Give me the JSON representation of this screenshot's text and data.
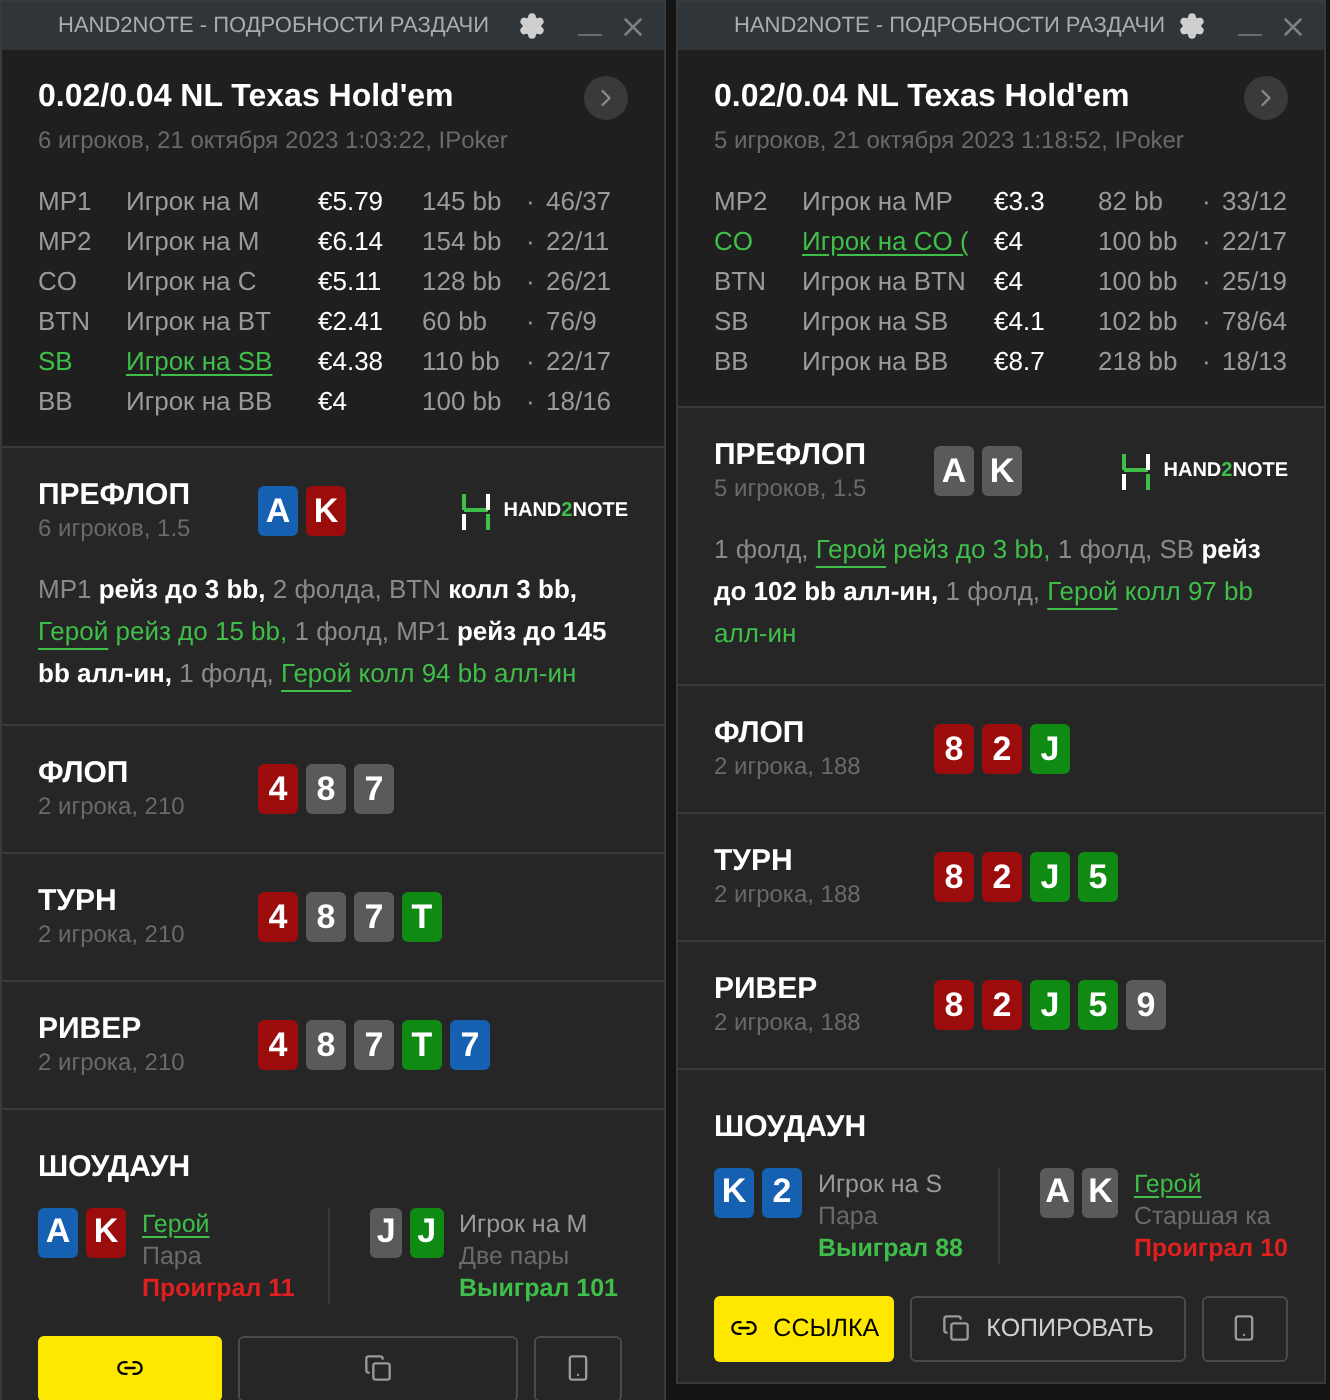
{
  "windows": [
    {
      "title": "HAND2NOTE - ПОДРОБНОСТИ РАЗДАЧИ",
      "game": "0.02/0.04 NL Texas Hold'em",
      "info": "6 игроков, 21 октября 2023 1:03:22, IPoker",
      "players": [
        {
          "pos": "MP1",
          "name": "Игрок на M",
          "stack": "€5.79",
          "bb": "145 bb",
          "dot": "·",
          "stats": "46/37",
          "hero": false
        },
        {
          "pos": "MP2",
          "name": "Игрок на M",
          "stack": "€6.14",
          "bb": "154 bb",
          "dot": "·",
          "stats": "22/11",
          "hero": false
        },
        {
          "pos": "CO",
          "name": "Игрок на C",
          "stack": "€5.11",
          "bb": "128 bb",
          "dot": "·",
          "stats": "26/21",
          "hero": false
        },
        {
          "pos": "BTN",
          "name": "Игрок на BT",
          "stack": "€2.41",
          "bb": "60 bb",
          "dot": "·",
          "stats": "76/9",
          "hero": false
        },
        {
          "pos": "SB",
          "name": "Игрок на SB",
          "stack": "€4.38",
          "bb": "110 bb",
          "dot": "·",
          "stats": "22/17",
          "hero": true
        },
        {
          "pos": "BB",
          "name": "Игрок на BB",
          "stack": "€4",
          "bb": "100 bb",
          "dot": "·",
          "stats": "18/16",
          "hero": false
        }
      ],
      "logo": [
        "HAND",
        "2",
        "NOTE"
      ],
      "streets": [
        {
          "name": "ПРЕФЛОП",
          "info": "6 игроков, 1.5",
          "cards": [
            {
              "rank": "A",
              "color": "#1560b0"
            },
            {
              "rank": "K",
              "color": "#9b0d0d"
            }
          ],
          "actions": [
            {
              "kind": "muted",
              "text": "MP1 "
            },
            {
              "kind": "action",
              "text": "рейз до 3 bb,"
            },
            {
              "kind": "muted",
              "text": " 2 фолда, BTN "
            },
            {
              "kind": "action",
              "text": "колл 3 bb, "
            },
            {
              "kind": "hero_name",
              "text": "Герой"
            },
            {
              "kind": "hero",
              "text": " рейз до 15 bb,"
            },
            {
              "kind": "muted",
              "text": " 1 фолд, MP1 "
            },
            {
              "kind": "action",
              "text": "рейз до 145 bb алл-ин,"
            },
            {
              "kind": "muted",
              "text": " 1 фолд, "
            },
            {
              "kind": "hero_name",
              "text": "Герой"
            },
            {
              "kind": "hero",
              "text": " колл 94 bb алл-ин"
            }
          ]
        },
        {
          "name": "ФЛОП",
          "info": "2 игрока, 210",
          "cards": [
            {
              "rank": "4",
              "color": "#9b0d0d"
            },
            {
              "rank": "8",
              "color": "#5a5a5a"
            },
            {
              "rank": "7",
              "color": "#5a5a5a"
            }
          ]
        },
        {
          "name": "ТУРН",
          "info": "2 игрока, 210",
          "cards": [
            {
              "rank": "4",
              "color": "#9b0d0d"
            },
            {
              "rank": "8",
              "color": "#5a5a5a"
            },
            {
              "rank": "7",
              "color": "#5a5a5a"
            },
            {
              "rank": "T",
              "color": "#0f8a12"
            }
          ]
        },
        {
          "name": "РИВЕР",
          "info": "2 игрока, 210",
          "cards": [
            {
              "rank": "4",
              "color": "#9b0d0d"
            },
            {
              "rank": "8",
              "color": "#5a5a5a"
            },
            {
              "rank": "7",
              "color": "#5a5a5a"
            },
            {
              "rank": "T",
              "color": "#0f8a12"
            },
            {
              "rank": "7",
              "color": "#1560b0"
            }
          ]
        }
      ],
      "showdown": {
        "title": "ШОУДАУН",
        "hands": [
          {
            "cards": [
              {
                "rank": "A",
                "color": "#1560b0"
              },
              {
                "rank": "K",
                "color": "#9b0d0d"
              }
            ],
            "player": "Герой",
            "hero": true,
            "combo": "Пара",
            "result": "Проиграл 11",
            "won": false
          },
          {
            "cards": [
              {
                "rank": "J",
                "color": "#5a5a5a"
              },
              {
                "rank": "J",
                "color": "#0f8a12"
              }
            ],
            "player": "Игрок на M",
            "hero": false,
            "combo": "Две пары",
            "result": "Выиграл 101",
            "won": true
          }
        ]
      }
    },
    {
      "title": "HAND2NOTE - ПОДРОБНОСТИ РАЗДАЧИ",
      "game": "0.02/0.04 NL Texas Hold'em",
      "info": "5 игроков, 21 октября 2023 1:18:52, IPoker",
      "players": [
        {
          "pos": "MP2",
          "name": "Игрок на MP",
          "stack": "€3.3",
          "bb": "82 bb",
          "dot": "·",
          "stats": "33/12",
          "hero": false
        },
        {
          "pos": "CO",
          "name": "Игрок на CO (",
          "stack": "€4",
          "bb": "100 bb",
          "dot": "·",
          "stats": "22/17",
          "hero": true
        },
        {
          "pos": "BTN",
          "name": "Игрок на BTN",
          "stack": "€4",
          "bb": "100 bb",
          "dot": "·",
          "stats": "25/19",
          "hero": false
        },
        {
          "pos": "SB",
          "name": "Игрок на SB",
          "stack": "€4.1",
          "bb": "102 bb",
          "dot": "·",
          "stats": "78/64",
          "hero": false
        },
        {
          "pos": "BB",
          "name": "Игрок на BB",
          "stack": "€8.7",
          "bb": "218 bb",
          "dot": "·",
          "stats": "18/13",
          "hero": false
        }
      ],
      "logo": [
        "HAND",
        "2",
        "NOTE"
      ],
      "streets": [
        {
          "name": "ПРЕФЛОП",
          "info": "5 игроков, 1.5",
          "cards": [
            {
              "rank": "A",
              "color": "#5a5a5a"
            },
            {
              "rank": "K",
              "color": "#5a5a5a"
            }
          ],
          "actions": [
            {
              "kind": "muted",
              "text": "1 фолд, "
            },
            {
              "kind": "hero_name",
              "text": "Герой"
            },
            {
              "kind": "hero",
              "text": " рейз до 3 bb,"
            },
            {
              "kind": "muted",
              "text": " 1 фолд, SB "
            },
            {
              "kind": "action",
              "text": "рейз до 102 bb алл-ин,"
            },
            {
              "kind": "muted",
              "text": " 1 фолд, "
            },
            {
              "kind": "hero_name",
              "text": "Герой"
            },
            {
              "kind": "hero",
              "text": " колл 97 bb алл-ин"
            }
          ]
        },
        {
          "name": "ФЛОП",
          "info": "2 игрока, 188",
          "cards": [
            {
              "rank": "8",
              "color": "#9b0d0d"
            },
            {
              "rank": "2",
              "color": "#9b0d0d"
            },
            {
              "rank": "J",
              "color": "#0f8a12"
            }
          ]
        },
        {
          "name": "ТУРН",
          "info": "2 игрока, 188",
          "cards": [
            {
              "rank": "8",
              "color": "#9b0d0d"
            },
            {
              "rank": "2",
              "color": "#9b0d0d"
            },
            {
              "rank": "J",
              "color": "#0f8a12"
            },
            {
              "rank": "5",
              "color": "#0f8a12"
            }
          ]
        },
        {
          "name": "РИВЕР",
          "info": "2 игрока, 188",
          "cards": [
            {
              "rank": "8",
              "color": "#9b0d0d"
            },
            {
              "rank": "2",
              "color": "#9b0d0d"
            },
            {
              "rank": "J",
              "color": "#0f8a12"
            },
            {
              "rank": "5",
              "color": "#0f8a12"
            },
            {
              "rank": "9",
              "color": "#5a5a5a"
            }
          ]
        }
      ],
      "showdown": {
        "title": "ШОУДАУН",
        "hands": [
          {
            "cards": [
              {
                "rank": "K",
                "color": "#1560b0"
              },
              {
                "rank": "2",
                "color": "#1560b0"
              }
            ],
            "player": "Игрок на S",
            "hero": false,
            "combo": "Пара",
            "result": "Выиграл 88",
            "won": true
          },
          {
            "cards": [
              {
                "rank": "A",
                "color": "#5a5a5a"
              },
              {
                "rank": "K",
                "color": "#5a5a5a"
              }
            ],
            "player": "Герой",
            "hero": true,
            "combo": "Старшая ка",
            "result": "Проиграл 10",
            "won": false
          }
        ]
      },
      "link": "ССЫЛКА",
      "copy": "КОПИРОВАТЬ"
    }
  ]
}
